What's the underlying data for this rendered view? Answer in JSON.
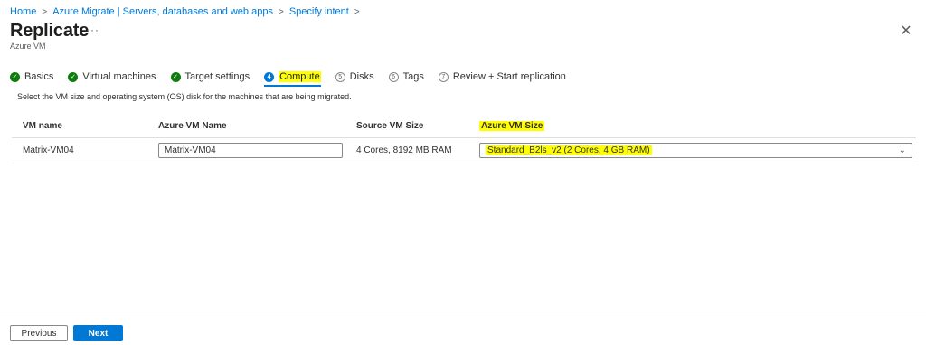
{
  "breadcrumb": [
    "Home",
    "Azure Migrate | Servers, databases and web apps",
    "Specify intent"
  ],
  "header": {
    "title": "Replicate",
    "more": "···",
    "subtitle": "Azure VM",
    "close": "✕"
  },
  "steps": [
    {
      "label": "Basics",
      "state": "done",
      "icon": "✓"
    },
    {
      "label": "Virtual machines",
      "state": "done",
      "icon": "✓"
    },
    {
      "label": "Target settings",
      "state": "done",
      "icon": "✓"
    },
    {
      "label": "Compute",
      "state": "current",
      "icon": "4"
    },
    {
      "label": "Disks",
      "state": "todo",
      "icon": "5"
    },
    {
      "label": "Tags",
      "state": "todo",
      "icon": "6"
    },
    {
      "label": "Review + Start replication",
      "state": "todo",
      "icon": "7"
    }
  ],
  "description": "Select the VM size and operating system (OS) disk for the machines that are being migrated.",
  "table": {
    "headers": [
      "VM name",
      "Azure VM Name",
      "Source VM Size",
      "Azure VM Size"
    ],
    "rows": [
      {
        "vm_name": "Matrix-VM04",
        "azure_vm_name": "Matrix-VM04",
        "source_size": "4 Cores, 8192 MB RAM",
        "azure_size": "Standard_B2ls_v2 (2 Cores, 4 GB RAM)"
      }
    ]
  },
  "footer": {
    "previous": "Previous",
    "next": "Next"
  },
  "colors": {
    "accent": "#0078d4",
    "success": "#107c10",
    "highlight": "#ffff00"
  }
}
